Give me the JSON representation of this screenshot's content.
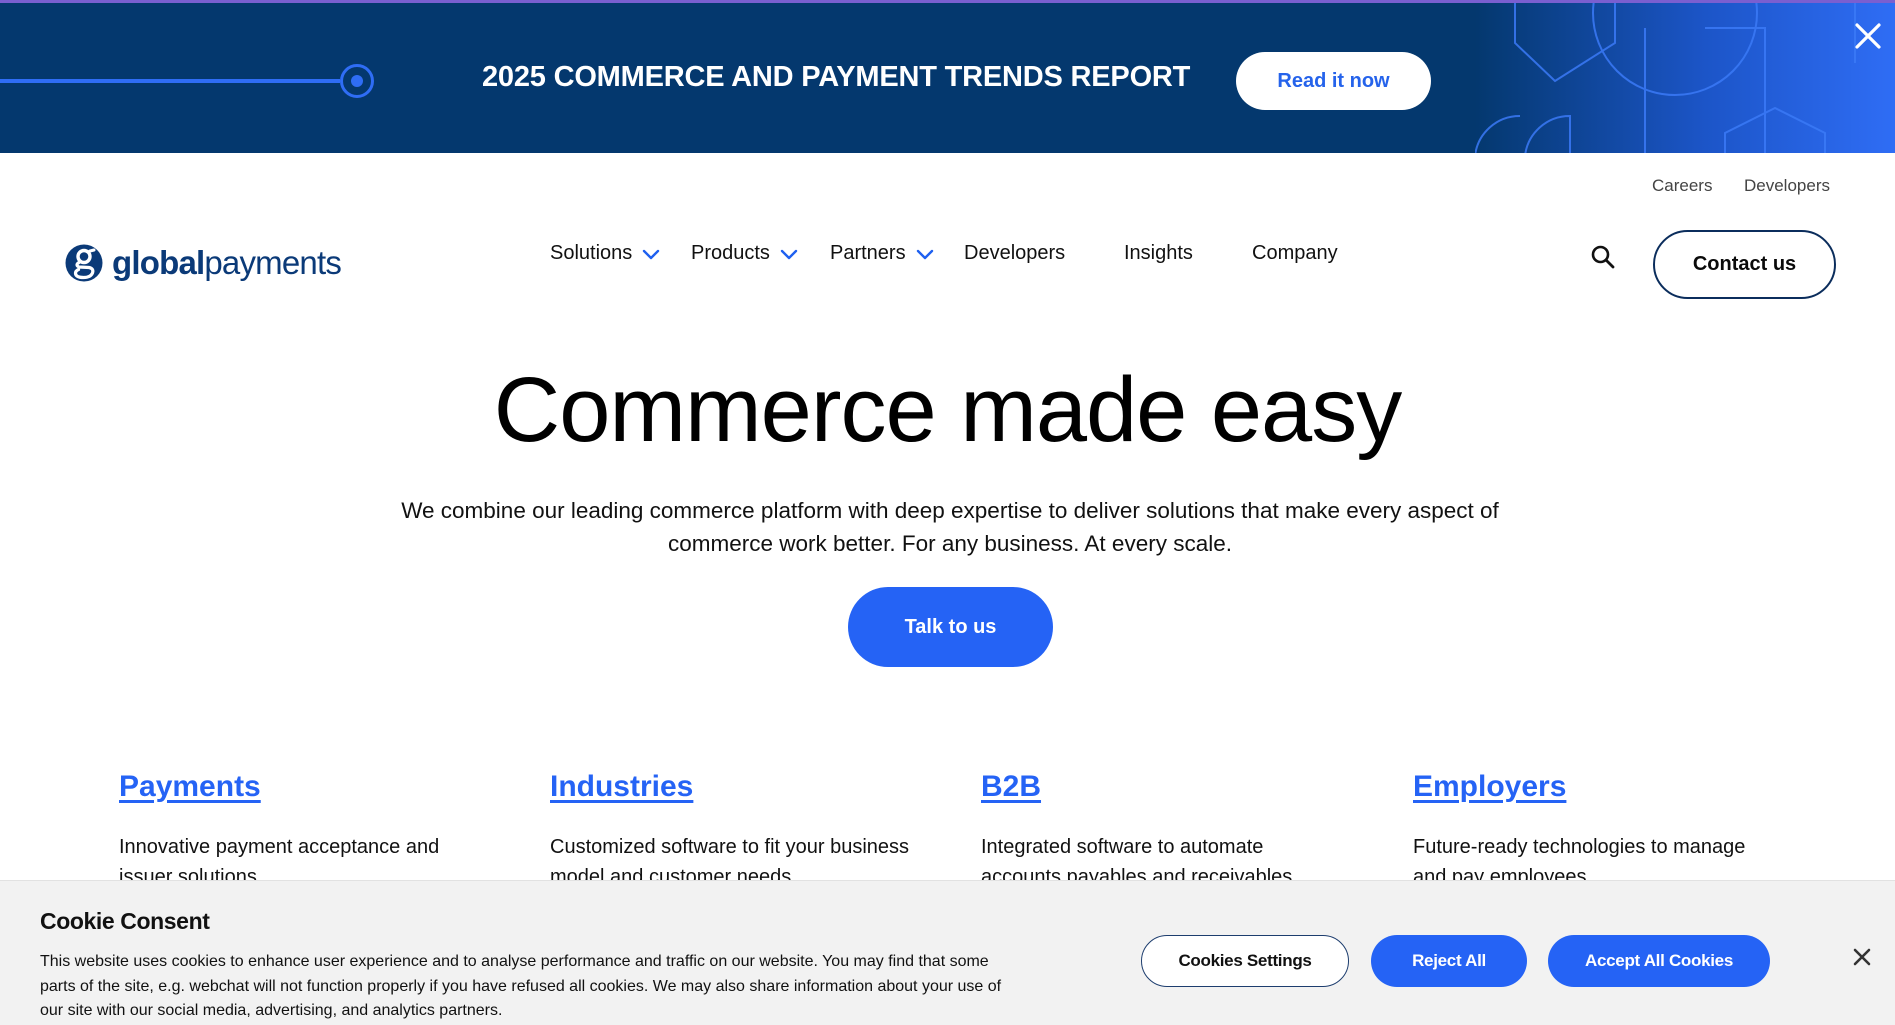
{
  "promo": {
    "title": "2025 COMMERCE AND PAYMENT TRENDS REPORT",
    "cta": "Read it now",
    "close_icon": "close-icon"
  },
  "header": {
    "utility": {
      "careers": "Careers",
      "developers": "Developers"
    },
    "logo": {
      "bold": "global",
      "light": "payments",
      "mark_icon": "globalpayments-g-logo"
    },
    "nav": [
      {
        "label": "Solutions",
        "has_dropdown": true
      },
      {
        "label": "Products",
        "has_dropdown": true
      },
      {
        "label": "Partners",
        "has_dropdown": true
      },
      {
        "label": "Developers",
        "has_dropdown": false
      },
      {
        "label": "Insights",
        "has_dropdown": false
      },
      {
        "label": "Company",
        "has_dropdown": false
      }
    ],
    "search_icon": "search-icon",
    "contact": "Contact us"
  },
  "hero": {
    "title": "Commerce made easy",
    "subtitle": "We combine our leading commerce platform with deep expertise to deliver solutions that make every aspect of commerce work better. For any business. At every scale.",
    "cta": "Talk to us"
  },
  "categories": [
    {
      "title": "Payments",
      "desc": "Innovative payment acceptance and issuer solutions."
    },
    {
      "title": "Industries",
      "desc": "Customized software to fit your business model and customer needs."
    },
    {
      "title": "B2B",
      "desc": "Integrated software to automate accounts payables and receivables."
    },
    {
      "title": "Employers",
      "desc": "Future-ready technologies to manage and pay employees."
    }
  ],
  "cookie": {
    "title": "Cookie Consent",
    "text": "This website uses cookies to enhance user experience and to analyse performance and traffic on our website. You may find that some parts of the site, e.g. webchat will not function properly if you have refused all cookies. We may also share information about your use of our site with our social media, advertising, and analytics partners.",
    "settings": "Cookies Settings",
    "reject": "Reject All",
    "accept": "Accept All Cookies"
  },
  "colors": {
    "banner_bg": "#04386e",
    "accent_blue": "#2563f5",
    "logo_navy": "#0b3a78"
  }
}
